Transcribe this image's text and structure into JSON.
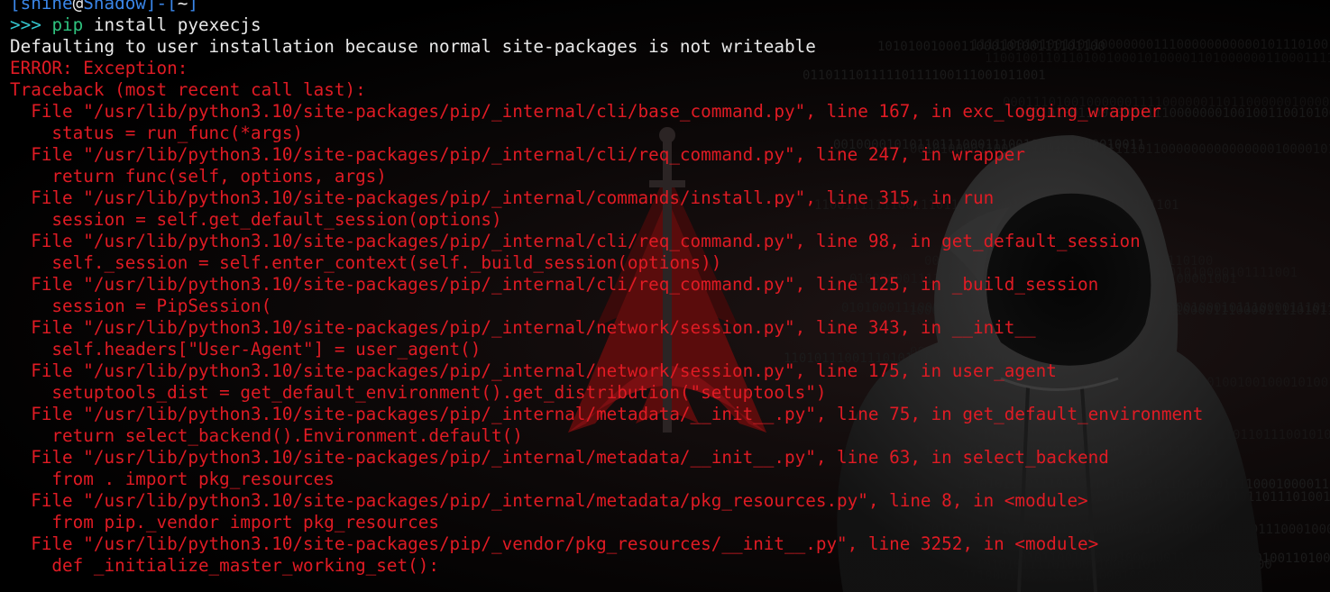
{
  "window": {
    "type": "terminal"
  },
  "prompt": {
    "bracket_open": "[",
    "user": "shine",
    "at": "@",
    "host": "Shadow",
    "separator": "]-[",
    "cwd": "~",
    "bracket_close": "]",
    "symbol": ">>>",
    "command_name": "pip",
    "command_args": "install pyexecjs"
  },
  "output": {
    "info_line": "Defaulting to user installation because normal site-packages is not writeable",
    "error_line": "ERROR: Exception:",
    "traceback_header": "Traceback (most recent call last):",
    "frames": [
      {
        "file_line": "  File \"/usr/lib/python3.10/site-packages/pip/_internal/cli/base_command.py\", line 167, in exc_logging_wrapper",
        "code_line": "    status = run_func(*args)"
      },
      {
        "file_line": "  File \"/usr/lib/python3.10/site-packages/pip/_internal/cli/req_command.py\", line 247, in wrapper",
        "code_line": "    return func(self, options, args)"
      },
      {
        "file_line": "  File \"/usr/lib/python3.10/site-packages/pip/_internal/commands/install.py\", line 315, in run",
        "code_line": "    session = self.get_default_session(options)"
      },
      {
        "file_line": "  File \"/usr/lib/python3.10/site-packages/pip/_internal/cli/req_command.py\", line 98, in get_default_session",
        "code_line": "    self._session = self.enter_context(self._build_session(options))"
      },
      {
        "file_line": "  File \"/usr/lib/python3.10/site-packages/pip/_internal/cli/req_command.py\", line 125, in _build_session",
        "code_line": "    session = PipSession("
      },
      {
        "file_line": "  File \"/usr/lib/python3.10/site-packages/pip/_internal/network/session.py\", line 343, in __init__",
        "code_line": "    self.headers[\"User-Agent\"] = user_agent()"
      },
      {
        "file_line": "  File \"/usr/lib/python3.10/site-packages/pip/_internal/network/session.py\", line 175, in user_agent",
        "code_line": "    setuptools_dist = get_default_environment().get_distribution(\"setuptools\")"
      },
      {
        "file_line": "  File \"/usr/lib/python3.10/site-packages/pip/_internal/metadata/__init__.py\", line 75, in get_default_environment",
        "code_line": "    return select_backend().Environment.default()"
      },
      {
        "file_line": "  File \"/usr/lib/python3.10/site-packages/pip/_internal/metadata/__init__.py\", line 63, in select_backend",
        "code_line": "    from . import pkg_resources"
      },
      {
        "file_line": "  File \"/usr/lib/python3.10/site-packages/pip/_internal/metadata/pkg_resources.py\", line 8, in <module>",
        "code_line": "    from pip._vendor import pkg_resources"
      },
      {
        "file_line": "  File \"/usr/lib/python3.10/site-packages/pip/_vendor/pkg_resources/__init__.py\", line 3252, in <module>",
        "code_line": "    def _initialize_master_working_set():"
      }
    ]
  },
  "theme": {
    "background": "#000000",
    "text_default": "#e8e8e8",
    "text_error": "#e01b24",
    "prompt_bracket": "#3a86e8",
    "prompt_symbol": "#34c7cf",
    "command_highlight": "#2ec27e"
  },
  "wallpaper": {
    "icons": [
      "arch-linux-logo-icon",
      "hooded-figure-icon",
      "binary-rain-pattern"
    ]
  }
}
